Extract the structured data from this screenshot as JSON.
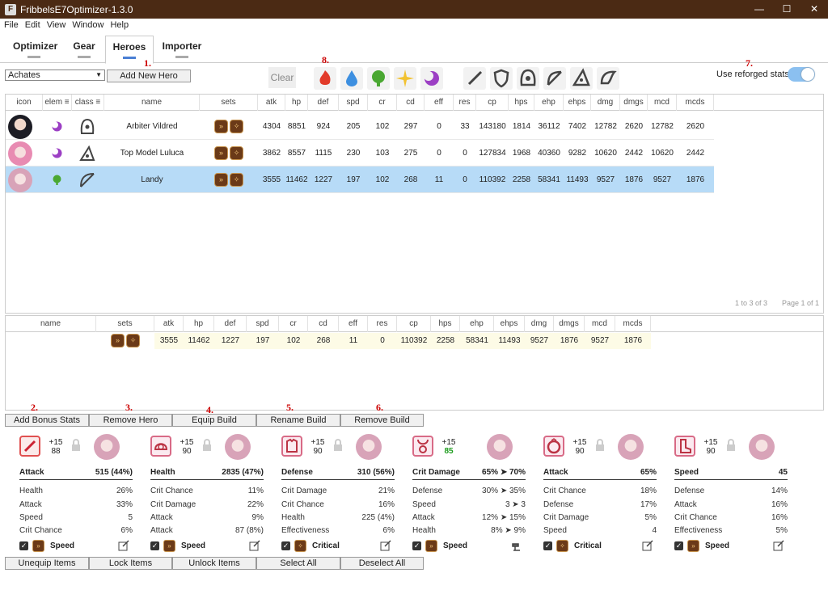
{
  "window": {
    "title": "FribbelsE7Optimizer-1.3.0"
  },
  "menu": [
    "File",
    "Edit",
    "View",
    "Window",
    "Help"
  ],
  "tabs": [
    "Optimizer",
    "Gear",
    "Heroes",
    "Importer"
  ],
  "toolbar": {
    "hero_select": "Achates",
    "add_hero": "Add New Hero",
    "clear": "Clear",
    "reforged_label": "Use reforged stats",
    "annotations": [
      "1.",
      "8.",
      "7."
    ]
  },
  "hero_headers": [
    "icon",
    "elem ≡",
    "class ≡",
    "name",
    "sets",
    "atk",
    "hp",
    "def",
    "spd",
    "cr",
    "cd",
    "eff",
    "res",
    "cp",
    "hps",
    "ehp",
    "ehps",
    "dmg",
    "dmgs",
    "mcd",
    "mcds"
  ],
  "heroes": [
    {
      "name": "Arbiter Vildred",
      "elem": "dark",
      "stats": [
        "4304",
        "8851",
        "924",
        "205",
        "102",
        "297",
        "0",
        "33",
        "143180",
        "1814",
        "36112",
        "7402",
        "12782",
        "2620",
        "12782",
        "2620"
      ]
    },
    {
      "name": "Top Model Luluca",
      "elem": "dark",
      "stats": [
        "3862",
        "8557",
        "1115",
        "230",
        "103",
        "275",
        "0",
        "0",
        "127834",
        "1968",
        "40360",
        "9282",
        "10620",
        "2442",
        "10620",
        "2442"
      ]
    },
    {
      "name": "Landy",
      "elem": "earth",
      "stats": [
        "3555",
        "11462",
        "1227",
        "197",
        "102",
        "268",
        "11",
        "0",
        "110392",
        "2258",
        "58341",
        "11493",
        "9527",
        "1876",
        "9527",
        "1876"
      ]
    }
  ],
  "pager": {
    "count": "1 to 3 of 3",
    "page": "Page 1 of 1"
  },
  "build_headers": [
    "name",
    "sets",
    "atk",
    "hp",
    "def",
    "spd",
    "cr",
    "cd",
    "eff",
    "res",
    "cp",
    "hps",
    "ehp",
    "ehps",
    "dmg",
    "dmgs",
    "mcd",
    "mcds"
  ],
  "build": {
    "name": "",
    "stats": [
      "3555",
      "11462",
      "1227",
      "197",
      "102",
      "268",
      "11",
      "0",
      "110392",
      "2258",
      "58341",
      "11493",
      "9527",
      "1876",
      "9527",
      "1876"
    ]
  },
  "actions": {
    "labels": [
      "Add Bonus Stats",
      "Remove Hero",
      "Equip Build",
      "Rename Build",
      "Remove Build"
    ],
    "annotations": [
      "2.",
      "3.",
      "4.",
      "5.",
      "6."
    ]
  },
  "items": [
    {
      "slot": "weapon",
      "plus": "+15",
      "level": "88",
      "main": {
        "stat": "Attack",
        "value": "515 (44%)"
      },
      "subs": [
        [
          "Health",
          "26%"
        ],
        [
          "Attack",
          "33%"
        ],
        [
          "Speed",
          "5"
        ],
        [
          "Crit Chance",
          "6%"
        ]
      ],
      "set": "Speed"
    },
    {
      "slot": "helmet",
      "plus": "+15",
      "level": "90",
      "main": {
        "stat": "Health",
        "value": "2835 (47%)"
      },
      "subs": [
        [
          "Crit Chance",
          "11%"
        ],
        [
          "Crit Damage",
          "22%"
        ],
        [
          "Attack",
          "9%"
        ],
        [
          "Attack",
          "87 (8%)"
        ]
      ],
      "set": "Speed"
    },
    {
      "slot": "armor",
      "plus": "+15",
      "level": "90",
      "main": {
        "stat": "Defense",
        "value": "310 (56%)"
      },
      "subs": [
        [
          "Crit Damage",
          "21%"
        ],
        [
          "Crit Chance",
          "16%"
        ],
        [
          "Health",
          "225 (4%)"
        ],
        [
          "Effectiveness",
          "6%"
        ]
      ],
      "set": "Critical"
    },
    {
      "slot": "necklace",
      "plus": "+15",
      "level": "85",
      "green": true,
      "main": {
        "stat": "Crit Damage",
        "value": "65% ➤ 70%"
      },
      "subs": [
        [
          "Defense",
          "30% ➤ 35%"
        ],
        [
          "Speed",
          "3 ➤ 3"
        ],
        [
          "Attack",
          "12% ➤ 15%"
        ],
        [
          "Health",
          "8% ➤ 9%"
        ]
      ],
      "set": "Speed"
    },
    {
      "slot": "ring",
      "plus": "+15",
      "level": "90",
      "main": {
        "stat": "Attack",
        "value": "65%"
      },
      "subs": [
        [
          "Crit Chance",
          "18%"
        ],
        [
          "Defense",
          "17%"
        ],
        [
          "Crit Damage",
          "5%"
        ],
        [
          "Speed",
          "4"
        ]
      ],
      "set": "Critical"
    },
    {
      "slot": "boots",
      "plus": "+15",
      "level": "90",
      "main": {
        "stat": "Speed",
        "value": "45"
      },
      "subs": [
        [
          "Defense",
          "14%"
        ],
        [
          "Attack",
          "16%"
        ],
        [
          "Crit Chance",
          "16%"
        ],
        [
          "Effectiveness",
          "5%"
        ]
      ],
      "set": "Speed"
    }
  ],
  "bottom": [
    "Unequip Items",
    "Lock Items",
    "Unlock Items",
    "Select All",
    "Deselect All"
  ],
  "colors": {
    "titlebar": "#4b2a14",
    "selected_row": "#b7dbf7",
    "build_row": "#fdfbe6",
    "accent": "#4a7fd4",
    "dark_elem": "#9c3fc4",
    "earth_elem": "#4aa832",
    "annotation": "#cc0000"
  }
}
